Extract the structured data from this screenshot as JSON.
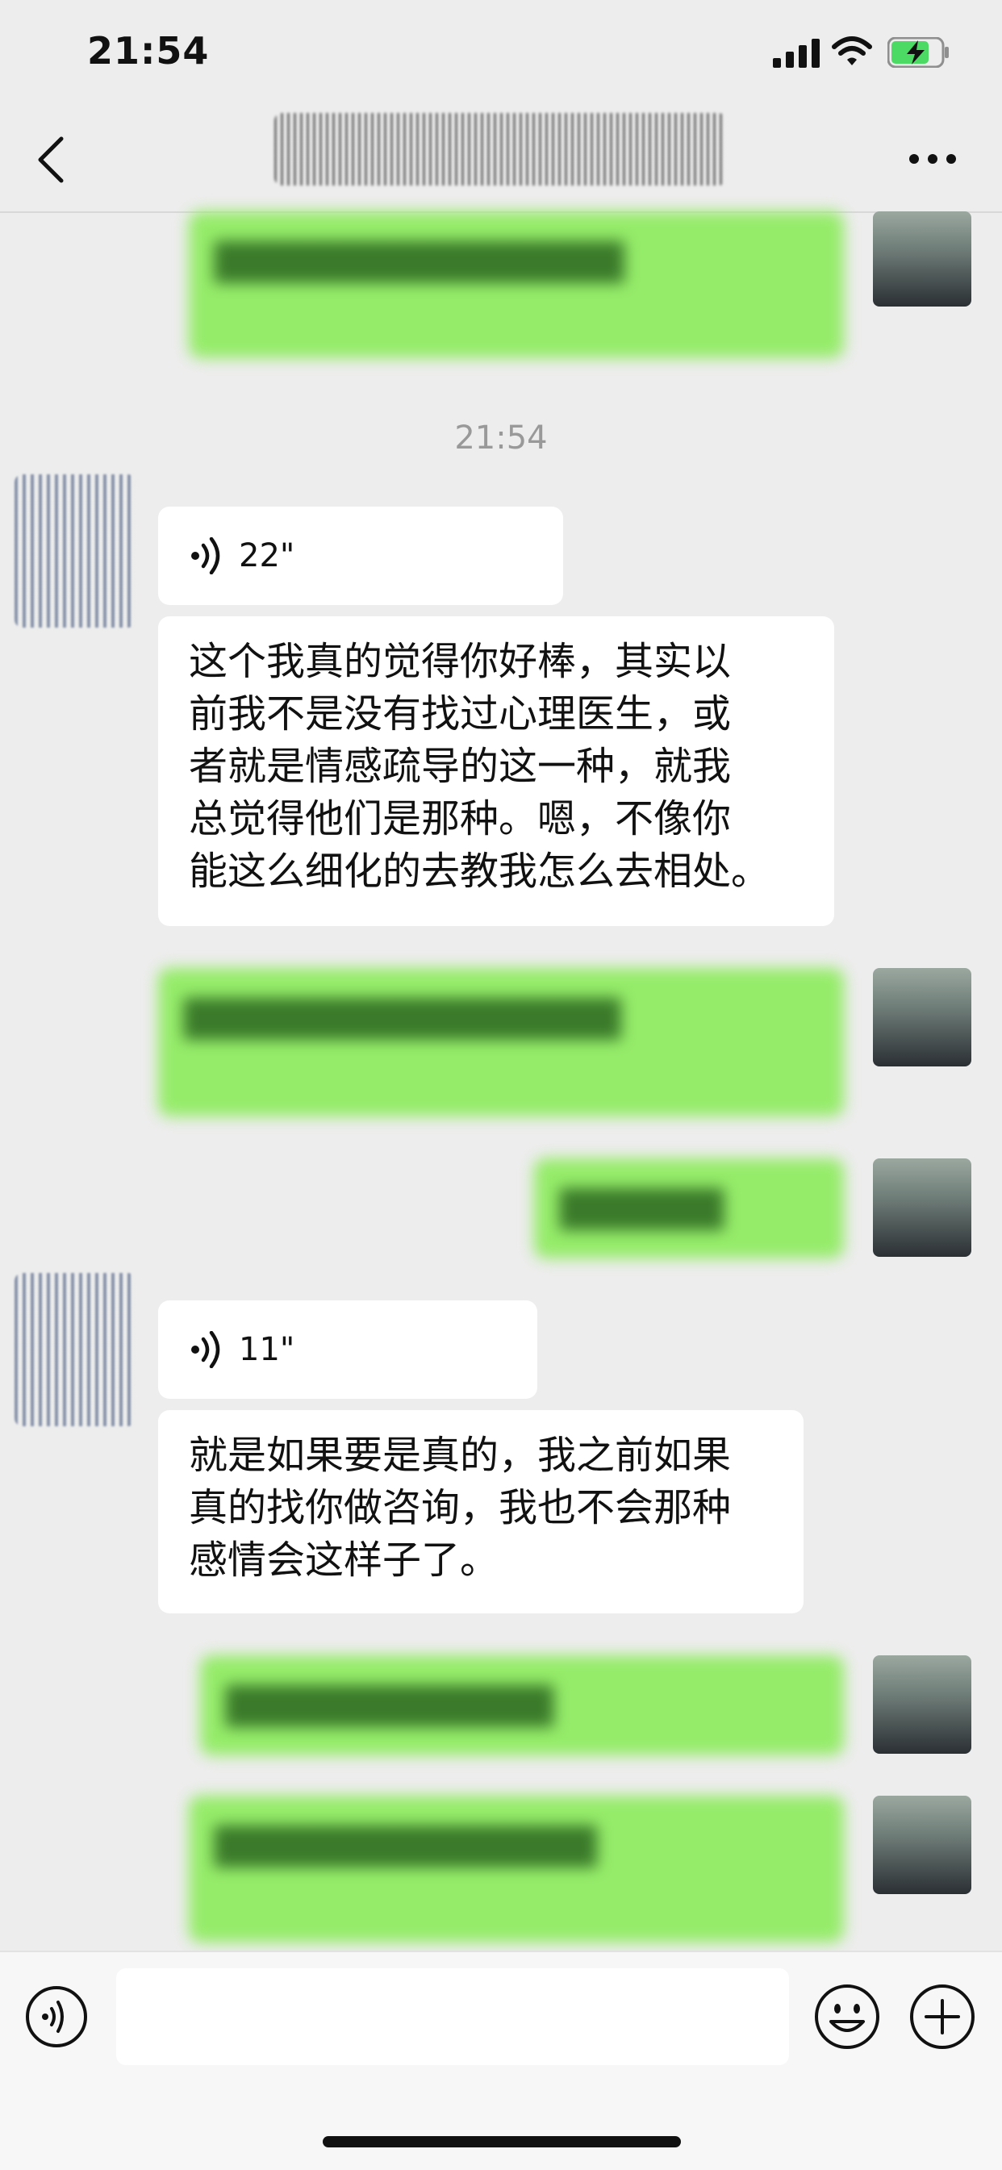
{
  "status_bar": {
    "time": "21:54"
  },
  "nav": {
    "title": "",
    "back_icon": "chevron-left-icon",
    "more_icon": "more-dots-icon"
  },
  "chat": {
    "timestamp": "21:54",
    "messages": [
      {
        "side": "out",
        "text": "",
        "blurred": true
      },
      {
        "side": "in",
        "type": "voice",
        "duration": "22\""
      },
      {
        "side": "in",
        "type": "text",
        "lines": [
          "这个我真的觉得你好棒，其实以",
          "前我不是没有找过心理医生，或",
          "者就是情感疏导的这一种，就我",
          "总觉得他们是那种。嗯，不像你",
          "能这么细化的去教我怎么去相处。"
        ]
      },
      {
        "side": "out",
        "text": "",
        "blurred": true
      },
      {
        "side": "out",
        "text": "",
        "blurred": true
      },
      {
        "side": "in",
        "type": "voice",
        "duration": "11\""
      },
      {
        "side": "in",
        "type": "text",
        "lines": [
          "就是如果要是真的，我之前如果",
          "真的找你做咨询，我也不会那种",
          "感情会这样子了。"
        ]
      },
      {
        "side": "out",
        "text": "",
        "blurred": true
      },
      {
        "side": "out",
        "text": "",
        "blurred": true
      }
    ]
  },
  "bottom_bar": {
    "voice_icon": "voice-input-icon",
    "emoji_icon": "emoji-icon",
    "plus_icon": "plus-icon",
    "input_value": ""
  },
  "colors": {
    "outgoing": "#95ec69",
    "incoming": "#ffffff",
    "background": "#ededed"
  }
}
